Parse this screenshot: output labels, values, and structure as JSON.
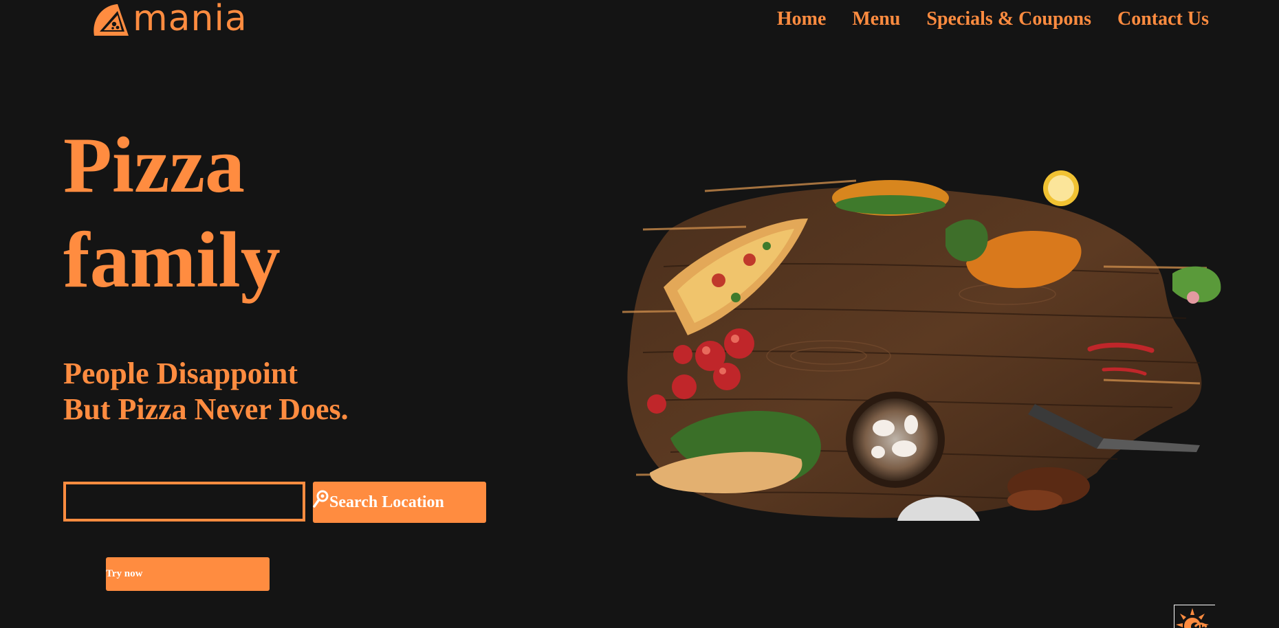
{
  "header": {
    "logo_text": "mania",
    "logo_icon": "pizza-slice-icon",
    "nav": [
      {
        "label": "Home"
      },
      {
        "label": "Menu"
      },
      {
        "label": "Specials & Coupons"
      },
      {
        "label": "Contact Us"
      }
    ]
  },
  "hero": {
    "title_line1": "Pizza",
    "title_line2": "family",
    "tagline_line1": "People Disappoint",
    "tagline_line2": "But Pizza Never Does.",
    "image_description_icon": "food-on-wooden-board-image"
  },
  "search": {
    "input_value": "",
    "button_label": "Search Location",
    "button_icon": "location-pin-icon"
  },
  "cta": {
    "try_label": "Try now"
  },
  "corner_widget": {
    "icon": "sun-icon"
  },
  "colors": {
    "background": "#141414",
    "accent": "#ff8c40",
    "button_text": "#ffffff"
  }
}
